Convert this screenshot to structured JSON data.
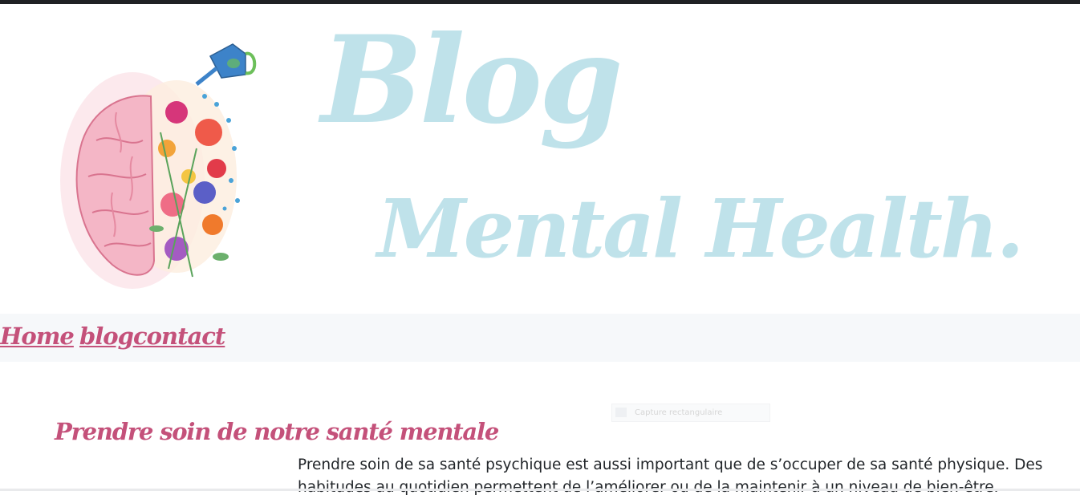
{
  "header": {
    "title_line1": "Blog",
    "title_line2": "Mental Health."
  },
  "nav": {
    "items": [
      {
        "label": "Home"
      },
      {
        "label": "blog"
      },
      {
        "label": "contact"
      }
    ]
  },
  "snip_tooltip": {
    "label": "Capture rectangulaire"
  },
  "post": {
    "title": "Prendre soin de notre santé mentale",
    "body_line1": "Prendre soin de sa santé psychique est aussi important que de s’occuper de sa santé physique. Des",
    "body_line2": "habitudes au quotidien permettent de l’améliorer ou de la maintenir à un niveau de bien-être."
  },
  "colors": {
    "title_blue": "#bfe2ea",
    "accent_pink": "#c4517a",
    "nav_bg": "#f6f8fa",
    "text": "#212529"
  },
  "icons": {
    "logo": "watercolor-brain-with-flowers-and-watering-can"
  }
}
